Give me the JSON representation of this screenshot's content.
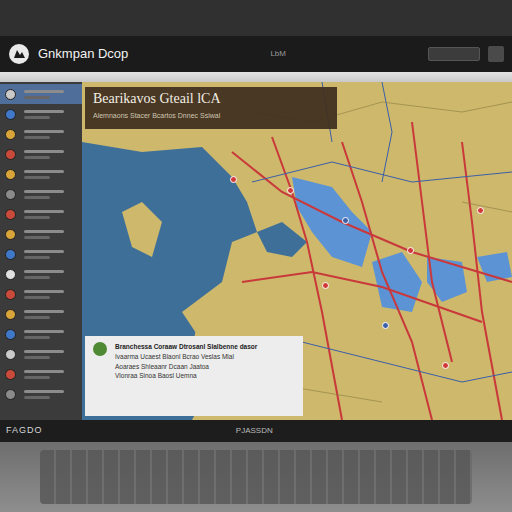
{
  "window": {
    "title": "Gnkmpan Dcop"
  },
  "header": {
    "center": "LbM"
  },
  "sidebar": {
    "items": [
      {
        "color": "#c9c9c9",
        "selected": true
      },
      {
        "color": "#3f78c8",
        "selected": false
      },
      {
        "color": "#d9a43a",
        "selected": false
      },
      {
        "color": "#c84a3a",
        "selected": false
      },
      {
        "color": "#d9a43a",
        "selected": false
      },
      {
        "color": "#8a8a8a",
        "selected": false
      },
      {
        "color": "#c84a3a",
        "selected": false
      },
      {
        "color": "#d9a43a",
        "selected": false
      },
      {
        "color": "#3f78c8",
        "selected": false
      },
      {
        "color": "#e0e0e0",
        "selected": false
      },
      {
        "color": "#c84a3a",
        "selected": false
      },
      {
        "color": "#d9a43a",
        "selected": false
      },
      {
        "color": "#3f78c8",
        "selected": false
      },
      {
        "color": "#c9c9c9",
        "selected": false
      },
      {
        "color": "#c84a3a",
        "selected": false
      },
      {
        "color": "#8a8a8a",
        "selected": false
      }
    ]
  },
  "map": {
    "title": "Bearikavos Gteail lCA",
    "subtitle": "Alemnaons Stacer Bcartos Dnnec Ssiwal"
  },
  "info": {
    "lines": [
      "Branchessa Coraaw Dtrosanl Slalbenne dasor",
      "Ivaarma Ucaest Blaonl Bcrao Veslas Mlal",
      "Aoaraes Shleaanr Dcaan Jaatoa",
      "Vlonraa Sinoa Baosl Uemna"
    ]
  },
  "bezel": {
    "left": "FAGDO",
    "center": "PJASSDN"
  }
}
